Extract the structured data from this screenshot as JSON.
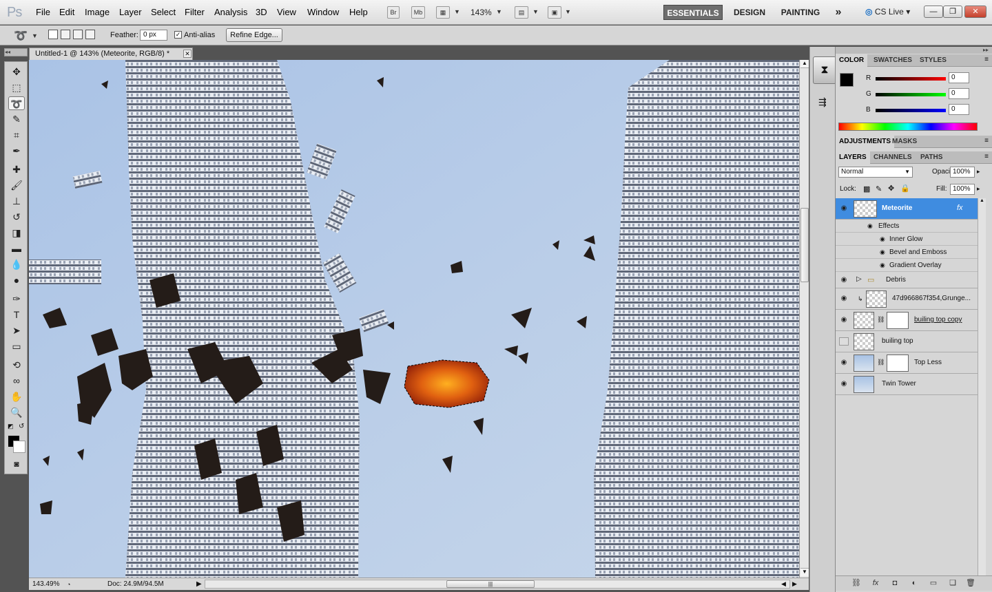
{
  "app": {
    "logo": "Ps"
  },
  "menu": [
    "File",
    "Edit",
    "Image",
    "Layer",
    "Select",
    "Filter",
    "Analysis",
    "3D",
    "View",
    "Window",
    "Help"
  ],
  "appbar": {
    "br": "Br",
    "mb": "Mb",
    "zoom": "143%"
  },
  "workspaces": {
    "essentials": "ESSENTIALS",
    "design": "DESIGN",
    "painting": "PAINTING",
    "more": "»"
  },
  "cslive": "CS Live",
  "options": {
    "feather_label": "Feather:",
    "feather_value": "0 px",
    "antialias_label": "Anti-alias",
    "antialias_checked": true,
    "refine_edge": "Refine Edge..."
  },
  "document": {
    "tab_title": "Untitled-1 @ 143% (Meteorite, RGB/8) *"
  },
  "status": {
    "zoom": "143.49%",
    "doc": "Doc: 24.9M/94.5M"
  },
  "color_panel": {
    "tabs": [
      "COLOR",
      "SWATCHES",
      "STYLES"
    ],
    "active_tab": "COLOR",
    "r_label": "R",
    "g_label": "G",
    "b_label": "B",
    "r": "0",
    "g": "0",
    "b": "0",
    "foreground": "#000000",
    "background": "#ffffff"
  },
  "adjust_panel": {
    "tabs": [
      "ADJUSTMENTS",
      "MASKS"
    ]
  },
  "layers_panel": {
    "tabs": [
      "LAYERS",
      "CHANNELS",
      "PATHS"
    ],
    "blend_mode": "Normal",
    "opacity_label": "Opacity:",
    "opacity": "100%",
    "lock_label": "Lock:",
    "fill_label": "Fill:",
    "fill": "100%",
    "layers": [
      {
        "name": "Meteorite",
        "selected": true,
        "visible": true,
        "fx": "fx"
      },
      {
        "name": "Debris",
        "group": true,
        "visible": true
      },
      {
        "name": "47d966867f354,Grunge...",
        "visible": true
      },
      {
        "name": "builing top copy",
        "visible": true
      },
      {
        "name": "builing top",
        "visible": false
      },
      {
        "name": "Top Less",
        "visible": true
      },
      {
        "name": "Twin Tower",
        "visible": true
      }
    ],
    "effects_label": "Effects",
    "effects": [
      "Inner Glow",
      "Bevel and Emboss",
      "Gradient Overlay"
    ]
  }
}
